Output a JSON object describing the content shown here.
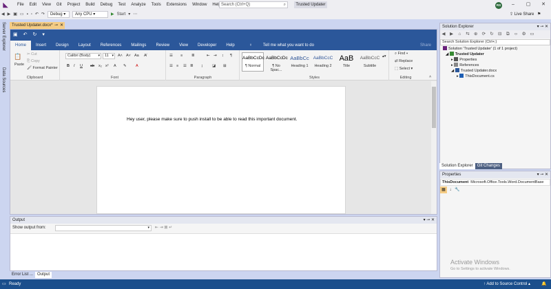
{
  "menubar": {
    "items": [
      "File",
      "Edit",
      "View",
      "Git",
      "Project",
      "Build",
      "Debug",
      "Test",
      "Analyze",
      "Tools",
      "Extensions",
      "Window",
      "Help"
    ],
    "search_placeholder": "Search (Ctrl+Q)",
    "solution_title": "Trusted Updater",
    "avatar_initials": "RS"
  },
  "toolbar": {
    "config": "Debug",
    "platform": "Any CPU",
    "start_label": "Start",
    "live_share": "Live Share"
  },
  "left_tabs": [
    "Server Explorer",
    "Data Sources"
  ],
  "document_tab": {
    "title": "Trusted Updater.docx*"
  },
  "word": {
    "ribbon_tabs": [
      "Home",
      "Insert",
      "Design",
      "Layout",
      "References",
      "Mailings",
      "Review",
      "View",
      "Developer",
      "Help"
    ],
    "tell_me": "Tell me what you want to do",
    "share": "Share",
    "clipboard": {
      "paste": "Paste",
      "cut": "Cut",
      "copy": "Copy",
      "format_painter": "Format Painter",
      "label": "Clipboard"
    },
    "font": {
      "name": "Calibri (Body)",
      "size": "11",
      "label": "Font"
    },
    "paragraph": {
      "label": "Paragraph"
    },
    "styles": {
      "label": "Styles",
      "items": [
        {
          "preview": "AaBbCcDc",
          "name": "¶ Normal"
        },
        {
          "preview": "AaBbCcDc",
          "name": "¶ No Spac..."
        },
        {
          "preview": "AaBbCc",
          "name": "Heading 1"
        },
        {
          "preview": "AaBbCcC",
          "name": "Heading 2"
        },
        {
          "preview": "AaB",
          "name": "Title"
        },
        {
          "preview": "AaBbCcC",
          "name": "Subtitle"
        }
      ]
    },
    "editing": {
      "find": "Find",
      "replace": "Replace",
      "select": "Select",
      "label": "Editing"
    },
    "document_text": "Hey user, please make sure to push install to be able to read this important document."
  },
  "output": {
    "title": "Output",
    "show_from": "Show output from:"
  },
  "bottom_tabs": [
    "Error List ...",
    "Output"
  ],
  "solution_explorer": {
    "title": "Solution Explorer",
    "search_placeholder": "Search Solution Explorer (Ctrl+;)",
    "tree": [
      {
        "label": "Solution 'Trusted Updater' (1 of 1 project)"
      },
      {
        "label": "Trusted Updater"
      },
      {
        "label": "Properties"
      },
      {
        "label": "References"
      },
      {
        "label": "Trusted Updater.docx"
      },
      {
        "label": "ThisDocument.cs"
      }
    ],
    "tabs": [
      "Solution Explorer",
      "Git Changes"
    ]
  },
  "properties": {
    "title": "Properties",
    "object_name": "ThisDocument",
    "object_type": "Microsoft.Office.Tools.Word.DocumentBase"
  },
  "watermark": {
    "title": "Activate Windows",
    "subtitle": "Go to Settings to activate Windows."
  },
  "status": {
    "ready": "Ready",
    "source_control": "Add to Source Control"
  }
}
